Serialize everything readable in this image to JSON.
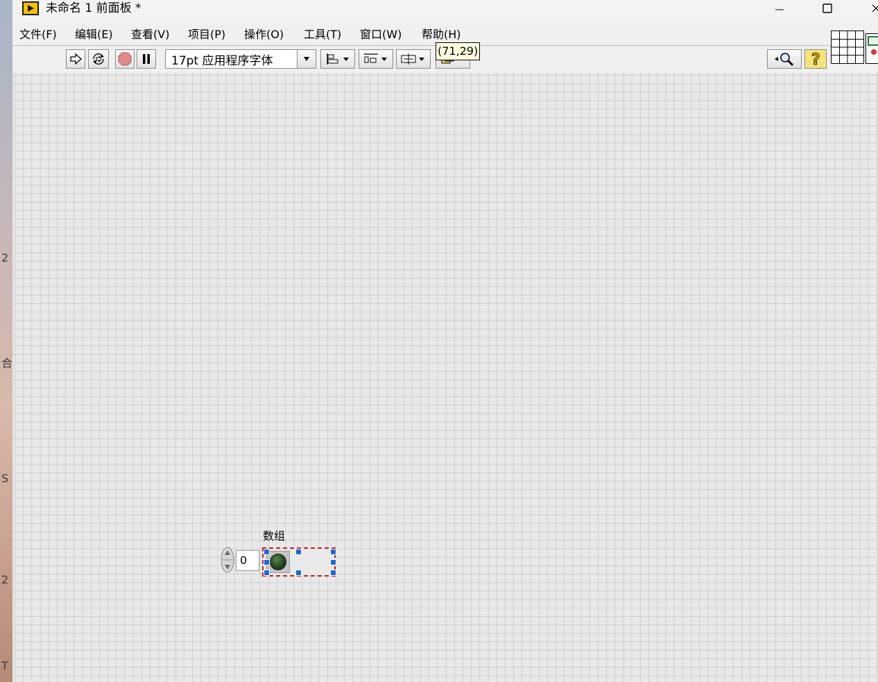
{
  "window": {
    "title": "未命名 1 前面板 *"
  },
  "desktop_strip_chars": [
    "2",
    "合",
    "S",
    "2",
    "T"
  ],
  "menu": {
    "items": [
      {
        "label": "文件(F)",
        "name": "menu-file"
      },
      {
        "label": "编辑(E)",
        "name": "menu-edit"
      },
      {
        "label": "查看(V)",
        "name": "menu-view"
      },
      {
        "label": "项目(P)",
        "name": "menu-project"
      },
      {
        "label": "操作(O)",
        "name": "menu-operate"
      },
      {
        "label": "工具(T)",
        "name": "menu-tools"
      },
      {
        "label": "窗口(W)",
        "name": "menu-window"
      },
      {
        "label": "帮助(H)",
        "name": "menu-help"
      }
    ]
  },
  "toolbar": {
    "font": "17pt 应用程序字体",
    "tooltip": "(71,29)",
    "icons": [
      "run-arrow-icon",
      "run-continuously-icon",
      "abort-icon",
      "pause-icon",
      "align-objects-icon",
      "distribute-objects-icon",
      "resize-objects-icon",
      "reorder-icon",
      "search-icon",
      "context-help-icon"
    ]
  },
  "front_panel": {
    "array": {
      "label": "数组",
      "index": "0",
      "element": "boolean-led"
    }
  },
  "colors": {
    "selection_dash": "#cc1e1e",
    "selection_handle": "#1a6ad8",
    "tooltip_bg": "#ffffe1",
    "led_off": "#244620"
  }
}
